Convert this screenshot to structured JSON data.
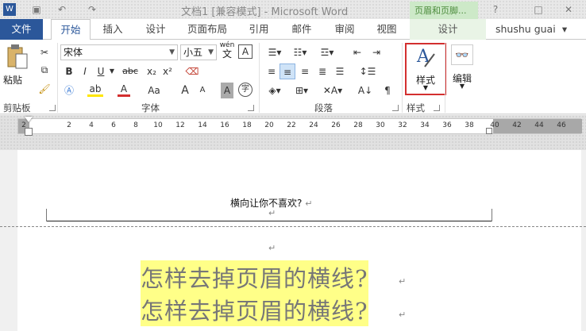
{
  "window": {
    "title": "文档1 [兼容模式] - Microsoft Word",
    "contextual_tab_group": "页眉和页脚...",
    "controls": [
      "?",
      "□",
      "✕"
    ]
  },
  "tabs": [
    {
      "label": "文件"
    },
    {
      "label": "开始"
    },
    {
      "label": "插入"
    },
    {
      "label": "设计"
    },
    {
      "label": "页面布局"
    },
    {
      "label": "引用"
    },
    {
      "label": "邮件"
    },
    {
      "label": "审阅"
    },
    {
      "label": "视图"
    },
    {
      "label": "设计"
    }
  ],
  "user": {
    "name": "shushu guai",
    "dropdown": "▾"
  },
  "ribbon": {
    "clipboard": {
      "paste_label": "粘贴",
      "group_label": "剪贴板"
    },
    "font": {
      "font_name": "宋体",
      "font_size": "小五",
      "wen_label": "wén",
      "wen_char": "文",
      "group_label": "字体",
      "bold": "B",
      "italic": "I",
      "underline": "U",
      "strike": "abc",
      "sub": "x₂",
      "sup": "x²",
      "case": "Aa",
      "grow": "A",
      "shrink": "A",
      "char_border": "A",
      "char_shade": "A",
      "enclose": "字"
    },
    "paragraph": {
      "group_label": "段落"
    },
    "styles": {
      "label": "样式",
      "group_label": "样式"
    },
    "editing": {
      "label": "编辑"
    }
  },
  "ruler": {
    "ticks": [
      "2",
      "2",
      "4",
      "6",
      "8",
      "10",
      "12",
      "14",
      "16",
      "18",
      "20",
      "22",
      "24",
      "26",
      "28",
      "30",
      "32",
      "34",
      "36",
      "38",
      "40",
      "42",
      "44",
      "46"
    ]
  },
  "document": {
    "header_text": "横向让你不喜欢?",
    "paragraph_mark": "↵",
    "lines": [
      "怎样去掉页眉的横线?",
      "怎样去掉页眉的横线?"
    ],
    "highlight_color": "#ffff88"
  },
  "colors": {
    "file_tab": "#2b579a",
    "styles_highlight_border": "#d32f2f",
    "font_color_bar": "#d32f2f",
    "highlight_bar": "#ffe600"
  }
}
